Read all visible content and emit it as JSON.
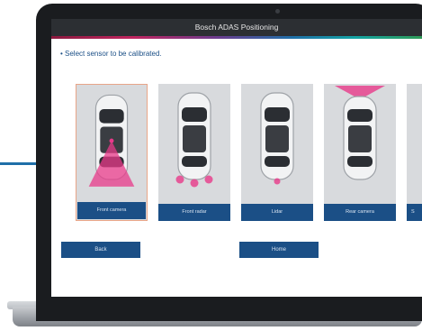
{
  "window": {
    "title": "Bosch ADAS Positioning"
  },
  "instruction": "• Select sensor to be calibrated.",
  "sensors": [
    {
      "label": "Front camera",
      "selected": true
    },
    {
      "label": "Front radar",
      "selected": false
    },
    {
      "label": "Lidar",
      "selected": false
    },
    {
      "label": "Rear camera",
      "selected": false
    },
    {
      "label": "S",
      "selected": false
    }
  ],
  "buttons": {
    "back": "Back",
    "home": "Home"
  },
  "colors": {
    "accent_blue": "#1b4f86",
    "sensor_highlight": "#e8398a",
    "selected_border": "#e8a588"
  }
}
